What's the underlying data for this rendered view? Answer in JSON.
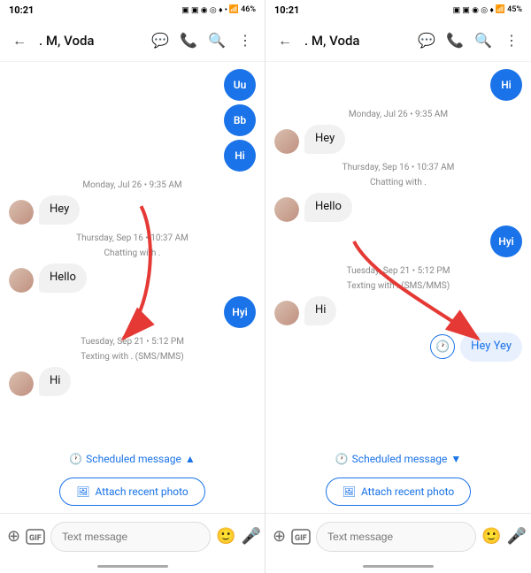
{
  "left_screen": {
    "status_bar": {
      "time": "10:21",
      "battery": "46%"
    },
    "top_bar": {
      "back_label": "←",
      "contact_name": ". M, Voda",
      "icons": [
        "chat",
        "phone",
        "search",
        "more"
      ]
    },
    "messages": [
      {
        "type": "sent_circle",
        "text": "Uu",
        "color": "blue"
      },
      {
        "type": "sent_circle",
        "text": "Bb",
        "color": "blue"
      },
      {
        "type": "sent",
        "text": "Hi",
        "color": "blue"
      },
      {
        "type": "timestamp",
        "text": "Monday, Jul 26 • 9:35 AM"
      },
      {
        "type": "received",
        "text": "Hey"
      },
      {
        "type": "timestamp",
        "text": "Thursday, Sep 16 • 10:37 AM"
      },
      {
        "type": "sublabel",
        "text": "Chatting with ."
      },
      {
        "type": "received",
        "text": "Hello"
      },
      {
        "type": "sent",
        "text": "Hyi",
        "color": "blue"
      },
      {
        "type": "timestamp",
        "text": "Tuesday, Sep 21 • 5:12 PM"
      },
      {
        "type": "sublabel",
        "text": "Texting with . (SMS/MMS)"
      },
      {
        "type": "received",
        "text": "Hi"
      }
    ],
    "scheduled_bar": {
      "icon": "🕐",
      "label": "Scheduled message",
      "arrow": "▲"
    },
    "attach_photo_btn": "Attach recent photo",
    "input_bar": {
      "add_icon": "+",
      "gif_icon": "gif",
      "placeholder": "Text message",
      "emoji_icon": "😊",
      "mic_icon": "🎤"
    }
  },
  "right_screen": {
    "status_bar": {
      "time": "10:21",
      "battery": "45%"
    },
    "top_bar": {
      "back_label": "←",
      "contact_name": ". M, Voda",
      "icons": [
        "chat",
        "phone",
        "search",
        "more"
      ]
    },
    "messages": [
      {
        "type": "sent",
        "text": "Hi",
        "color": "blue"
      },
      {
        "type": "timestamp",
        "text": "Monday, Jul 26 • 9:35 AM"
      },
      {
        "type": "received",
        "text": "Hey"
      },
      {
        "type": "timestamp",
        "text": "Thursday, Sep 16 • 10:37 AM"
      },
      {
        "type": "sublabel",
        "text": "Chatting with ."
      },
      {
        "type": "received",
        "text": "Hello"
      },
      {
        "type": "sent",
        "text": "Hyi",
        "color": "blue"
      },
      {
        "type": "timestamp",
        "text": "Tuesday, Sep 21 • 5:12 PM"
      },
      {
        "type": "sublabel",
        "text": "Texting with . (SMS/MMS)"
      },
      {
        "type": "received",
        "text": "Hi"
      },
      {
        "type": "scheduled_bubble",
        "text": "Hey Yey"
      }
    ],
    "scheduled_bar": {
      "icon": "🕐",
      "label": "Scheduled message",
      "arrow": "▼"
    },
    "attach_photo_btn": "Attach recent photo",
    "input_bar": {
      "add_icon": "+",
      "gif_icon": "gif",
      "placeholder": "Text message",
      "emoji_icon": "😊",
      "mic_icon": "🎤"
    }
  }
}
